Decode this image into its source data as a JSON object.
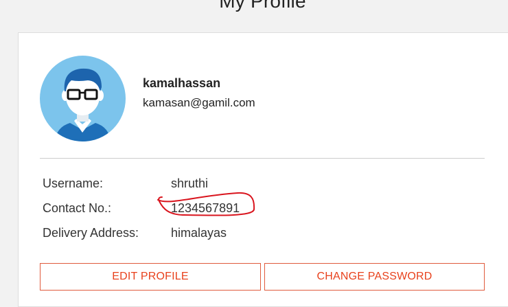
{
  "page": {
    "title": "My Profile"
  },
  "profile": {
    "name": "kamalhassan",
    "email": "kamasan@gamil.com",
    "avatar_icon": "user-avatar-icon"
  },
  "details": [
    {
      "label": "Username:",
      "value": "shruthi"
    },
    {
      "label": "Contact No.:",
      "value": "1234567891"
    },
    {
      "label": "Delivery Address:",
      "value": "himalayas"
    }
  ],
  "actions": {
    "edit_label": "EDIT PROFILE",
    "password_label": "CHANGE PASSWORD"
  },
  "colors": {
    "accent": "#e8411c",
    "annotation": "#d9141d",
    "avatar_bg": "#7cc4ec"
  }
}
